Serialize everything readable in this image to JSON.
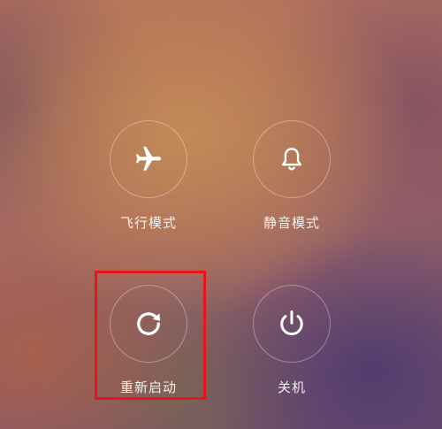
{
  "power_menu": {
    "items": [
      {
        "label": "飞行模式",
        "icon": "airplane-icon"
      },
      {
        "label": "静音模式",
        "icon": "bell-icon"
      },
      {
        "label": "重新启动",
        "icon": "restart-icon"
      },
      {
        "label": "关机",
        "icon": "power-icon"
      }
    ]
  },
  "colors": {
    "icon": "#ffffff",
    "highlight": "#e8141a"
  }
}
